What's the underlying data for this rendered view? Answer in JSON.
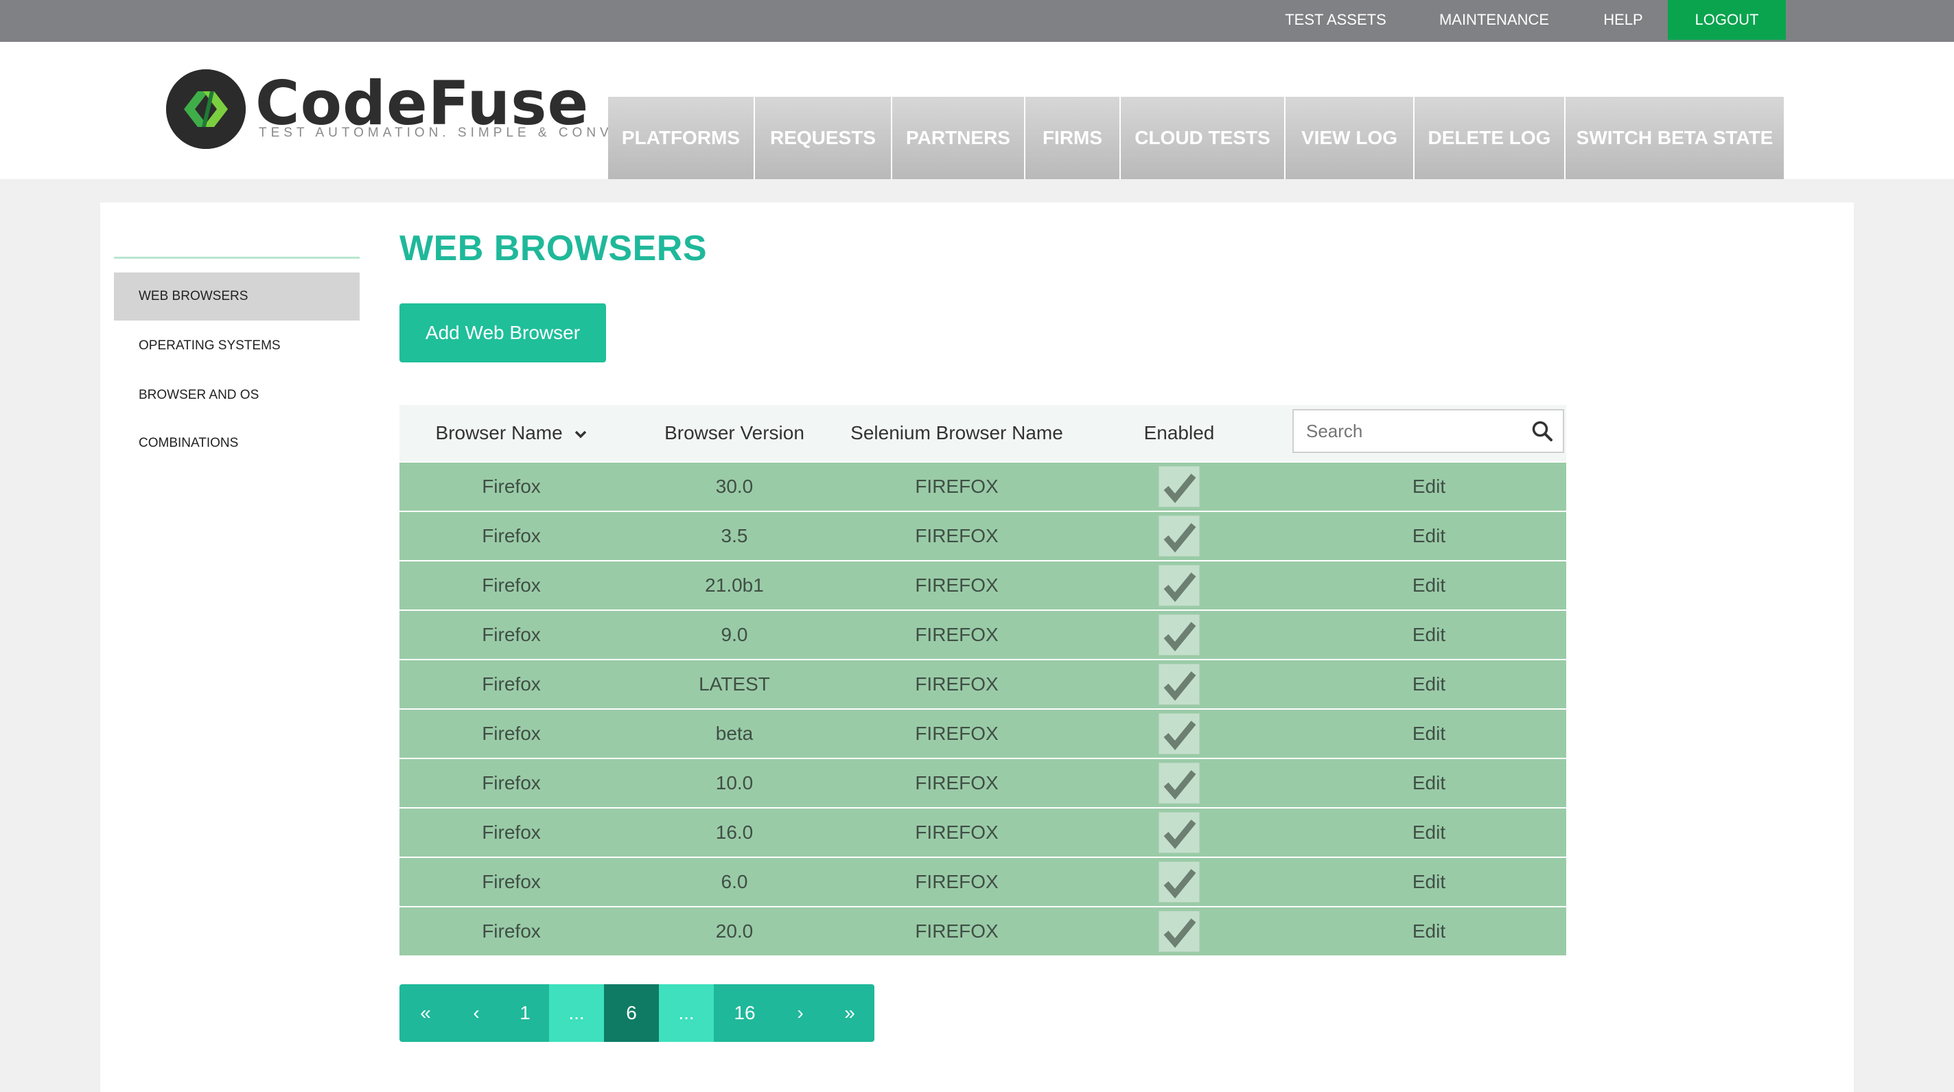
{
  "topbar": {
    "items": [
      "TEST ASSETS",
      "MAINTENANCE",
      "HELP"
    ],
    "logout": "LOGOUT",
    "logout_color": "#0aa44f"
  },
  "brand": {
    "name": "CodeFuse",
    "tagline": "TEST AUTOMATION. SIMPLE & CONVENIENT."
  },
  "nav": [
    "PLATFORMS",
    "REQUESTS",
    "PARTNERS",
    "FIRMS",
    "CLOUD TESTS",
    "VIEW LOG",
    "DELETE LOG",
    "SWITCH BETA STATE"
  ],
  "sidebar": {
    "items": [
      "WEB BROWSERS",
      "OPERATING SYSTEMS",
      "BROWSER AND OS COMBINATIONS"
    ],
    "active": "WEB BROWSERS"
  },
  "page": {
    "title": "WEB BROWSERS",
    "add_button": "Add Web Browser",
    "accent": "#1fb89a"
  },
  "table": {
    "columns": [
      "Browser Name",
      "Browser Version",
      "Selenium Browser Name",
      "Enabled"
    ],
    "sort_icon": "chevron-down-icon",
    "search_placeholder": "Search",
    "rows": [
      {
        "name": "Firefox",
        "version": "30.0",
        "selenium": "FIREFOX",
        "enabled": true,
        "action": "Edit"
      },
      {
        "name": "Firefox",
        "version": "3.5",
        "selenium": "FIREFOX",
        "enabled": true,
        "action": "Edit"
      },
      {
        "name": "Firefox",
        "version": "21.0b1",
        "selenium": "FIREFOX",
        "enabled": true,
        "action": "Edit"
      },
      {
        "name": "Firefox",
        "version": "9.0",
        "selenium": "FIREFOX",
        "enabled": true,
        "action": "Edit"
      },
      {
        "name": "Firefox",
        "version": "LATEST",
        "selenium": "FIREFOX",
        "enabled": true,
        "action": "Edit"
      },
      {
        "name": "Firefox",
        "version": "beta",
        "selenium": "FIREFOX",
        "enabled": true,
        "action": "Edit"
      },
      {
        "name": "Firefox",
        "version": "10.0",
        "selenium": "FIREFOX",
        "enabled": true,
        "action": "Edit"
      },
      {
        "name": "Firefox",
        "version": "16.0",
        "selenium": "FIREFOX",
        "enabled": true,
        "action": "Edit"
      },
      {
        "name": "Firefox",
        "version": "6.0",
        "selenium": "FIREFOX",
        "enabled": true,
        "action": "Edit"
      },
      {
        "name": "Firefox",
        "version": "20.0",
        "selenium": "FIREFOX",
        "enabled": true,
        "action": "Edit"
      }
    ],
    "row_color": "#9acba7"
  },
  "pagination": {
    "first": "«",
    "prev": "‹",
    "pages": [
      "1",
      "...",
      "6",
      "...",
      "16"
    ],
    "current": "6",
    "next": "›",
    "last": "»"
  }
}
